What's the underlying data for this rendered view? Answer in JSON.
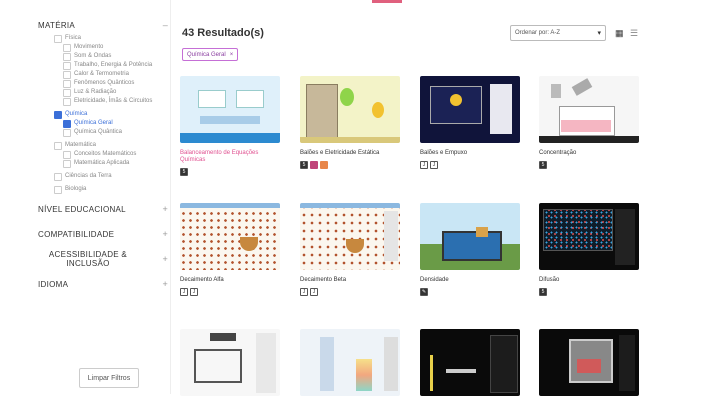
{
  "sidebar": {
    "materia": {
      "heading": "MATÉRIA",
      "toggle": "–",
      "items": [
        {
          "label": "Física",
          "level": 1,
          "checked": false
        },
        {
          "label": "Movimento",
          "level": 2,
          "checked": false
        },
        {
          "label": "Som & Ondas",
          "level": 2,
          "checked": false
        },
        {
          "label": "Trabalho, Energia & Potência",
          "level": 2,
          "checked": false
        },
        {
          "label": "Calor & Termometria",
          "level": 2,
          "checked": false
        },
        {
          "label": "Fenômenos Quânticos",
          "level": 2,
          "checked": false
        },
        {
          "label": "Luz & Radiação",
          "level": 2,
          "checked": false
        },
        {
          "label": "Eletricidade, Ímãs & Circuitos",
          "level": 2,
          "checked": false
        },
        {
          "label": "Química",
          "level": 1,
          "checked": true
        },
        {
          "label": "Química Geral",
          "level": 2,
          "checked": true
        },
        {
          "label": "Química Quântica",
          "level": 2,
          "checked": false
        },
        {
          "label": "Matemática",
          "level": 1,
          "checked": false
        },
        {
          "label": "Conceitos Matemáticos",
          "level": 2,
          "checked": false
        },
        {
          "label": "Matemática Aplicada",
          "level": 2,
          "checked": false
        },
        {
          "label": "Ciências da Terra",
          "level": 1,
          "checked": false
        },
        {
          "label": "Biologia",
          "level": 1,
          "checked": false
        }
      ]
    },
    "nivel": {
      "heading": "NÍVEL EDUCACIONAL",
      "toggle": "+"
    },
    "compat": {
      "heading": "COMPATIBILIDADE",
      "toggle": "+"
    },
    "acess": {
      "heading": "ACESSIBILIDADE & INCLUSÃO",
      "toggle": "+"
    },
    "idioma": {
      "heading": "IDIOMA",
      "toggle": "+"
    },
    "clear_label": "Limpar Filtros"
  },
  "main": {
    "results_label": "43 Resultado(s)",
    "active_filter": "Química Geral",
    "active_filter_close": "×",
    "sort": {
      "label": "Ordenar por: A-Z",
      "chevron": "▾"
    },
    "view_grid_icon": "▦",
    "view_list_icon": "☰",
    "cards": [
      {
        "title": "Balanceamento de Equações Químicas",
        "highlight": true,
        "badges": [
          "html5"
        ]
      },
      {
        "title": "Balões e Eletricidade Estática",
        "highlight": false,
        "badges": [
          "html5",
          "accessibility",
          "sound"
        ]
      },
      {
        "title": "Balões e Empuxo",
        "highlight": false,
        "badges": [
          "java",
          "java"
        ]
      },
      {
        "title": "Concentração",
        "highlight": false,
        "badges": [
          "html5"
        ]
      },
      {
        "title": "Decaimento Alfa",
        "highlight": false,
        "badges": [
          "java",
          "java"
        ]
      },
      {
        "title": "Decaimento Beta",
        "highlight": false,
        "badges": [
          "java",
          "java"
        ]
      },
      {
        "title": "Densidade",
        "highlight": false,
        "badges": [
          "pencil"
        ]
      },
      {
        "title": "Difusão",
        "highlight": false,
        "badges": [
          "html5"
        ]
      },
      {
        "title": "",
        "highlight": false,
        "badges": []
      },
      {
        "title": "",
        "highlight": false,
        "badges": []
      },
      {
        "title": "",
        "highlight": false,
        "badges": []
      },
      {
        "title": "",
        "highlight": false,
        "badges": []
      }
    ]
  }
}
